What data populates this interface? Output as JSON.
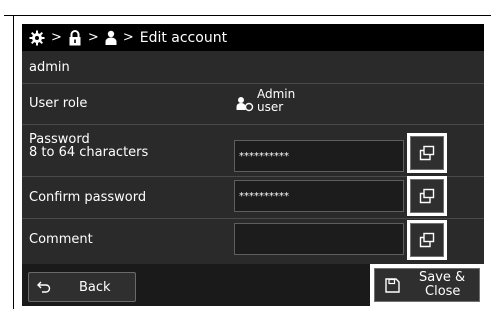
{
  "breadcrumb": {
    "icons": [
      "gear-icon",
      "lock-icon",
      "user-icon"
    ],
    "separator": ">",
    "current": "Edit account"
  },
  "account": {
    "name": "admin"
  },
  "user_role": {
    "label": "User role",
    "value_line1": "Admin",
    "value_line2": "user",
    "icon": "user-role-icon"
  },
  "password": {
    "label_line1": "Password",
    "label_line2": "8 to 64 characters",
    "value": "**********"
  },
  "confirm_password": {
    "label": "Confirm password",
    "value": "**********"
  },
  "comment": {
    "label": "Comment",
    "value": ""
  },
  "footer": {
    "back_label": "Back",
    "save_line1": "Save &",
    "save_line2": "Close"
  },
  "colors": {
    "background": "#2a2a2a",
    "header": "#000000",
    "text": "#ffffff",
    "highlight": "#ffffff"
  }
}
